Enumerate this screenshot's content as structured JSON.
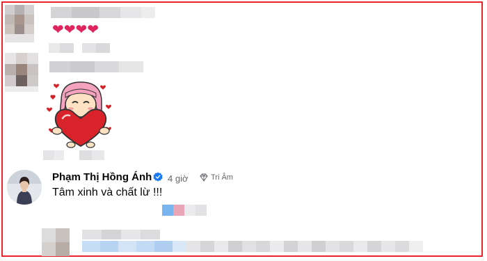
{
  "comment1": {
    "reaction_icons": [
      "heart",
      "heart",
      "heart",
      "heart"
    ]
  },
  "comment2": {
    "sticker_icon": "girl-holding-heart-sticker"
  },
  "comment3": {
    "author_name": "Phạm Thị Hồng Ánh",
    "verified_icon": "verified-badge-icon",
    "timestamp": "4 giờ",
    "badge_icon": "diamond-icon",
    "badge_label": "Tri Âm",
    "text": "Tâm xinh và chất lừ !!!"
  },
  "colors": {
    "border": "#e8232a",
    "heart": "#e0245e",
    "verified": "#1877f2",
    "meta_text": "#65676b"
  }
}
